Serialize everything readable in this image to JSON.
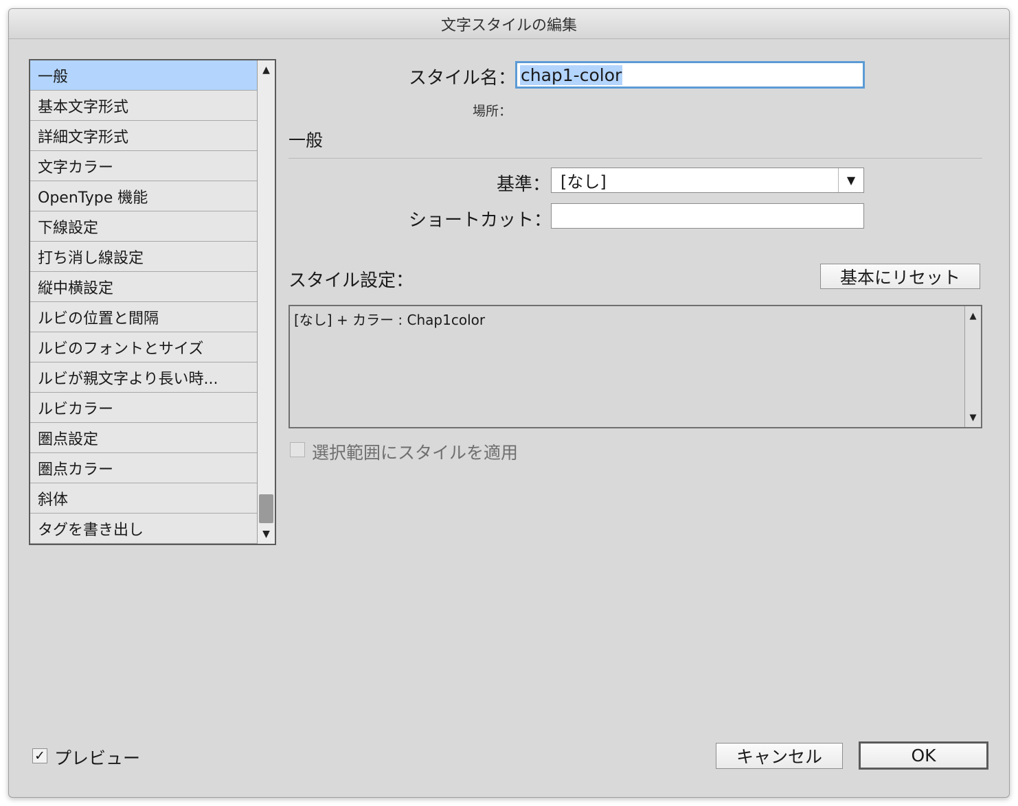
{
  "window": {
    "title": "文字スタイルの編集"
  },
  "categories": [
    {
      "label": "一般",
      "selected": true
    },
    {
      "label": "基本文字形式"
    },
    {
      "label": "詳細文字形式"
    },
    {
      "label": "文字カラー"
    },
    {
      "label": "OpenType 機能"
    },
    {
      "label": "下線設定"
    },
    {
      "label": "打ち消し線設定"
    },
    {
      "label": "縦中横設定"
    },
    {
      "label": "ルビの位置と間隔"
    },
    {
      "label": "ルビのフォントとサイズ"
    },
    {
      "label": "ルビが親文字より長い時..."
    },
    {
      "label": "ルビカラー"
    },
    {
      "label": "圏点設定"
    },
    {
      "label": "圏点カラー"
    },
    {
      "label": "斜体"
    },
    {
      "label": "タグを書き出し"
    }
  ],
  "icons": {
    "scroll_up": "scroll-up-arrow-icon",
    "scroll_down": "scroll-down-arrow-icon",
    "dropdown": "dropdown-arrow-icon",
    "checkmark": "checkmark-icon"
  },
  "form": {
    "style_name_label": "スタイル名：",
    "style_name_value": "chap1-color",
    "location_label": "場所：",
    "section_title": "一般",
    "based_on_label": "基準：",
    "based_on_value": "[なし]",
    "shortcut_label": "ショートカット：",
    "shortcut_value": "",
    "style_settings_label": "スタイル設定：",
    "reset_button": "基本にリセット",
    "style_settings_text": "[なし] + カラー : Chap1color",
    "apply_to_selection_label": "選択範囲にスタイルを適用",
    "apply_to_selection_checked": false
  },
  "footer": {
    "preview_label": "プレビュー",
    "preview_checked": true,
    "cancel_button": "キャンセル",
    "ok_button": "OK"
  },
  "colors": {
    "selection_highlight": "#b3d4fc",
    "focus_ring": "#5b9bd5",
    "dialog_background": "#d9d9d9"
  }
}
